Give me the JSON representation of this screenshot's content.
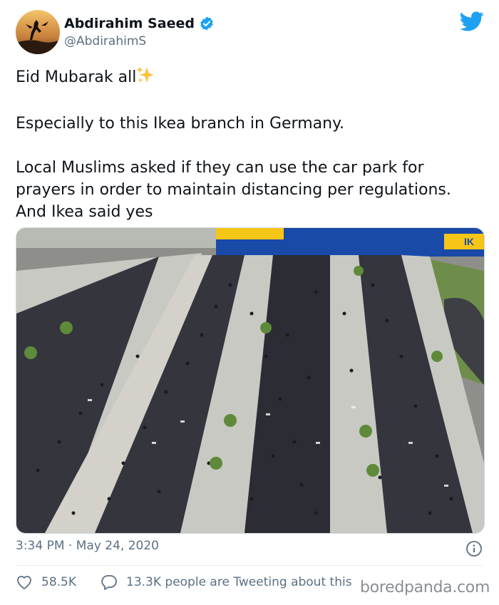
{
  "user": {
    "name": "Abdirahim Saeed",
    "handle": "@AbdirahimS",
    "verified": true
  },
  "tweet": {
    "line1": "Eid Mubarak all",
    "line1_emoji": "sparkles-emoji",
    "line2": "Especially to this Ikea branch in Germany.",
    "line3": "Local Muslims asked if they can use the car park for prayers in order to maintain distancing per regulations. And Ikea said yes"
  },
  "media": {
    "store_sign": "IK",
    "icon": "photo-car-park-prayers"
  },
  "meta": {
    "timestamp": "3:34 PM · May 24, 2020"
  },
  "actions": {
    "likes": "58.5K",
    "tweeting": "13.3K people are Tweeting about this"
  },
  "watermark": "boredpanda.com",
  "colors": {
    "twitter_blue": "#1da1f2",
    "ikea_blue": "#1a4aa8",
    "ikea_yellow": "#f5c518",
    "asphalt": "#34353d",
    "pavement": "#c9c9c4"
  }
}
